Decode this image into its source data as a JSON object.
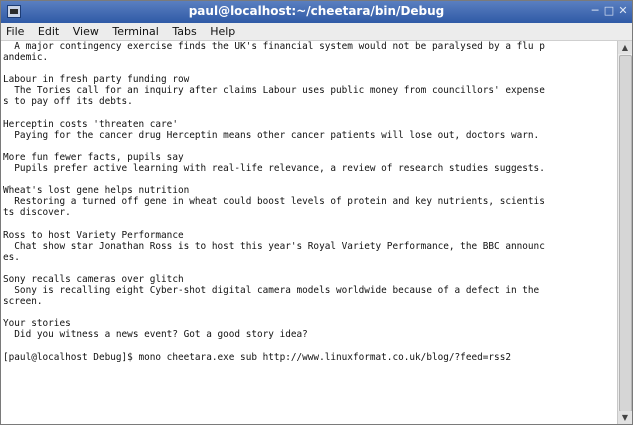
{
  "window": {
    "title": "paul@localhost:~/cheetara/bin/Debug"
  },
  "menu": [
    "File",
    "Edit",
    "View",
    "Terminal",
    "Tabs",
    "Help"
  ],
  "terminal_lines": [
    "  A major contingency exercise finds the UK's financial system would not be paralysed by a flu p",
    "andemic.",
    "",
    "Labour in fresh party funding row",
    "  The Tories call for an inquiry after claims Labour uses public money from councillors' expense",
    "s to pay off its debts.",
    "",
    "Herceptin costs 'threaten care'",
    "  Paying for the cancer drug Herceptin means other cancer patients will lose out, doctors warn.",
    "",
    "More fun fewer facts, pupils say",
    "  Pupils prefer active learning with real-life relevance, a review of research studies suggests.",
    "",
    "Wheat's lost gene helps nutrition",
    "  Restoring a turned off gene in wheat could boost levels of protein and key nutrients, scientis",
    "ts discover.",
    "",
    "Ross to host Variety Performance",
    "  Chat show star Jonathan Ross is to host this year's Royal Variety Performance, the BBC announc",
    "es.",
    "",
    "Sony recalls cameras over glitch",
    "  Sony is recalling eight Cyber-shot digital camera models worldwide because of a defect in the",
    "screen.",
    "",
    "Your stories",
    "  Did you witness a news event? Got a good story idea?",
    "",
    "[paul@localhost Debug]$ mono cheetara.exe sub http://www.linuxformat.co.uk/blog/?feed=rss2"
  ]
}
